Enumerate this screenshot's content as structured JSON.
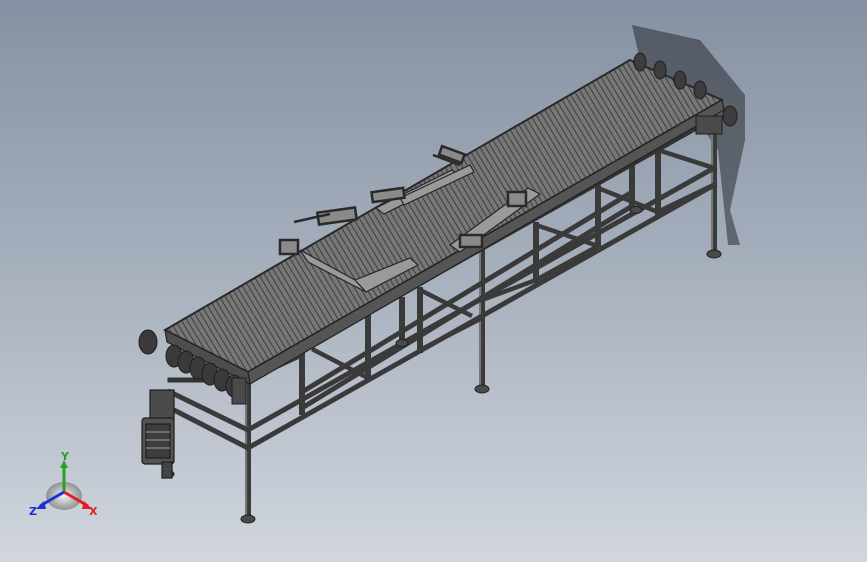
{
  "viewport": {
    "background_top": "#8591a2",
    "background_bottom": "#d1d6de"
  },
  "model": {
    "name": "belt-conveyor-assembly",
    "frame_color": "#3a3a3a",
    "belt_color": "#6f6f6f"
  },
  "triad": {
    "x_label": "X",
    "y_label": "Y",
    "z_label": "Z",
    "x_color": "#e02020",
    "y_color": "#2aa02a",
    "z_color": "#2030d8"
  }
}
